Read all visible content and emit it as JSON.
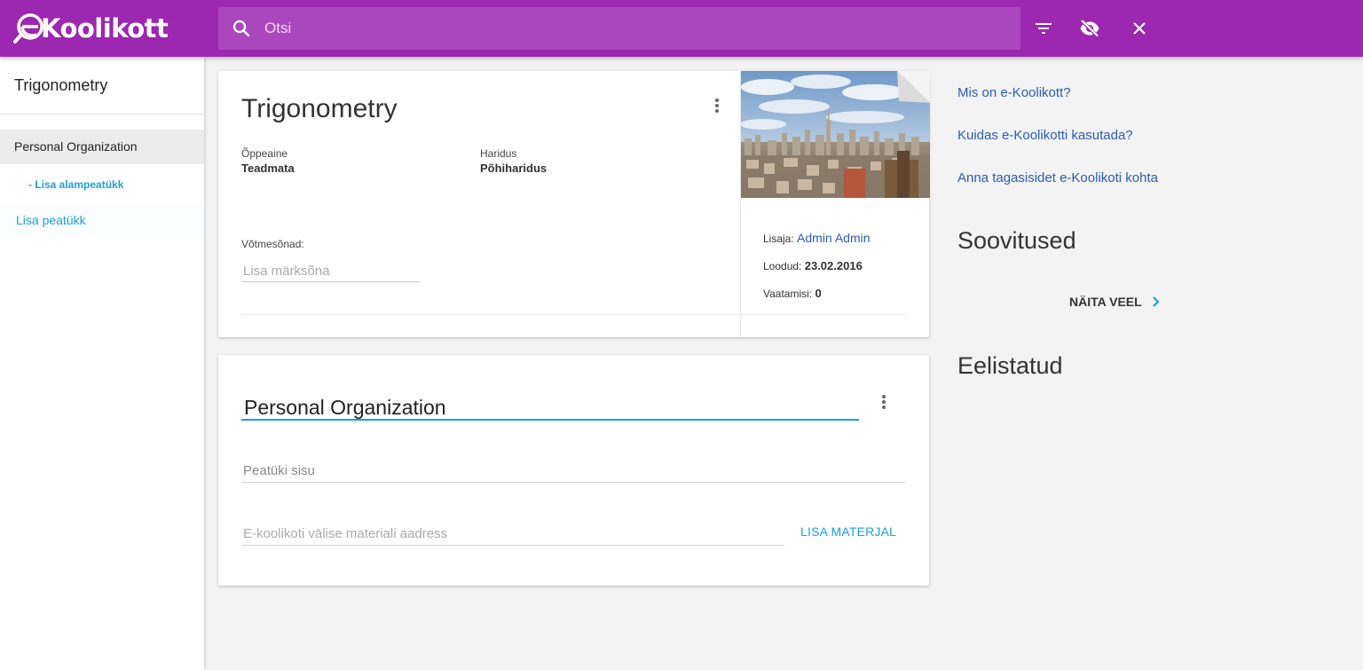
{
  "app": {
    "logo_text": "Koolikott",
    "brand_color": "#9c27b0",
    "accent_color": "#1e9fdc"
  },
  "header": {
    "search_placeholder": "Otsi",
    "icons": [
      "search-icon",
      "filter-icon",
      "visibility-off-icon",
      "close-icon"
    ]
  },
  "sidebar": {
    "title": "Trigonometry",
    "chapter": "Personal Organization",
    "add_subchapter": "- Lisa alampeatükk",
    "add_chapter": "Lisa peatükk"
  },
  "material": {
    "title": "Trigonometry",
    "subject_label": "Õppeaine",
    "subject_value": "Teadmata",
    "education_label": "Haridus",
    "education_value": "Põhiharidus",
    "keywords_label": "Võtmesõnad:",
    "keywords_placeholder": "Lisa märksõna",
    "added_by_label": "Lisaja:",
    "added_by_value": "Admin Admin",
    "created_label": "Loodud:",
    "created_value": "23.02.2016",
    "views_label": "Vaatamisi:",
    "views_value": "0"
  },
  "chapter": {
    "title": "Personal Organization",
    "content_placeholder": "Peatüki sisu",
    "url_placeholder": "E-koolikoti välise materiali aadress",
    "add_material": "LISA MATERJAL"
  },
  "right": {
    "links": [
      "Mis on e-Koolikott?",
      "Kuidas e-Koolikotti kasutada?",
      "Anna tagasisidet e-Koolikoti kohta"
    ],
    "recommendations_heading": "Soovitused",
    "show_more": "NÄITA VEEL",
    "favorites_heading": "Eelistatud"
  }
}
